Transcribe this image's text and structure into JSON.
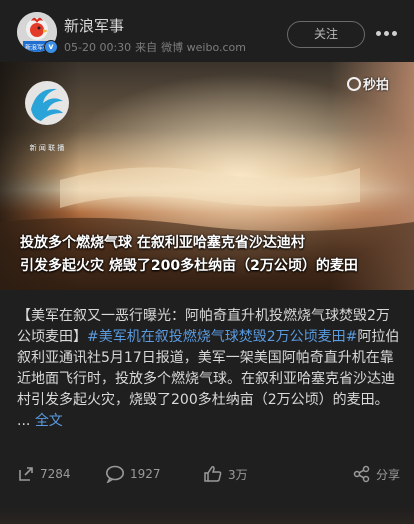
{
  "author": {
    "name": "新浪军事",
    "avatar_text": "新浪军事",
    "timestamp": "05-20 00:30",
    "source_prefix": "来自",
    "source": "微博 weibo.com"
  },
  "follow_label": "关注",
  "video": {
    "logo_text": "新 闻 联 播",
    "watermark": "秒拍",
    "caption_line1": "投放多个燃烧气球 在叙利亚哈塞克省沙达迪村",
    "caption_line2": "引发多起火灾 烧毁了200多杜纳亩（2万公顷）的麦田"
  },
  "post": {
    "lead": "【美军在叙又一恶行曝光：阿帕奇直升机投燃烧气球焚毁2万公顷麦田】",
    "hashtag": "#美军机在叙投燃烧气球焚毁2万公顷麦田#",
    "body": "阿拉伯叙利亚通讯社5月17日报道，美军一架美国阿帕奇直升机在靠近地面飞行时，投放多个燃烧气球。在叙利亚哈塞克省沙达迪村引发多起火灾，烧毁了200多杜纳亩（2万公顷）的麦田。 ... ",
    "more_link": "全文"
  },
  "actions": {
    "repost_count": "7284",
    "comment_count": "1927",
    "like_count": "3万",
    "share_label": "分享"
  }
}
